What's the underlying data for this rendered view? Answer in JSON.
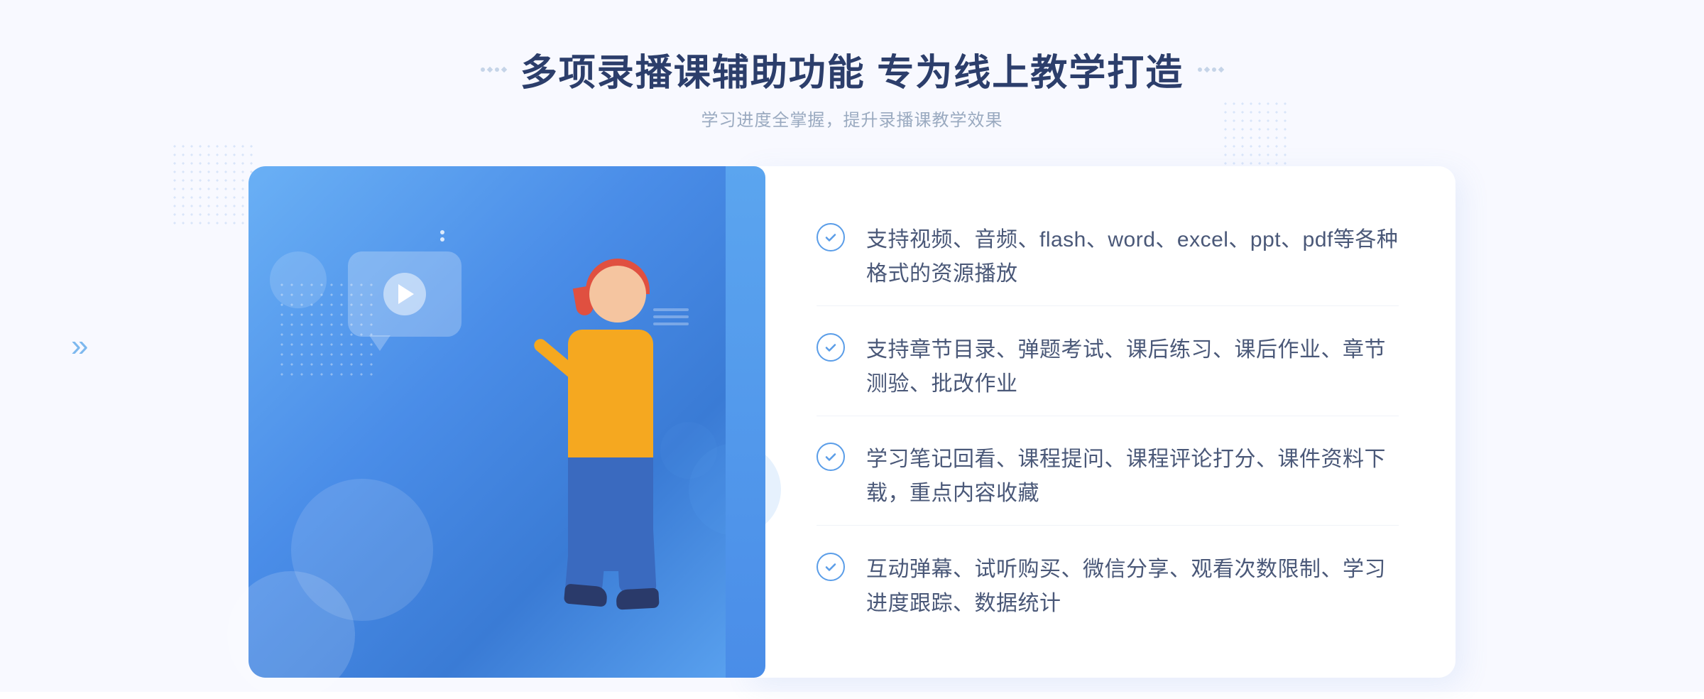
{
  "header": {
    "title": "多项录播课辅助功能 专为线上教学打造",
    "subtitle": "学习进度全掌握，提升录播课教学效果",
    "decorator_left": "❖",
    "decorator_right": "❖"
  },
  "features": [
    {
      "id": "feature-1",
      "text": "支持视频、音频、flash、word、excel、ppt、pdf等各种格式的资源播放"
    },
    {
      "id": "feature-2",
      "text": "支持章节目录、弹题考试、课后练习、课后作业、章节测验、批改作业"
    },
    {
      "id": "feature-3",
      "text": "学习笔记回看、课程提问、课程评论打分、课件资料下载，重点内容收藏"
    },
    {
      "id": "feature-4",
      "text": "互动弹幕、试听购买、微信分享、观看次数限制、学习进度跟踪、数据统计"
    }
  ],
  "colors": {
    "primary_blue": "#4a8de8",
    "light_blue": "#6ab0f5",
    "text_dark": "#2c3e6b",
    "text_body": "#4a5878",
    "text_sub": "#9aaac0",
    "check_color": "#5a9de8"
  },
  "chevron_left": "»",
  "play_label": "play"
}
